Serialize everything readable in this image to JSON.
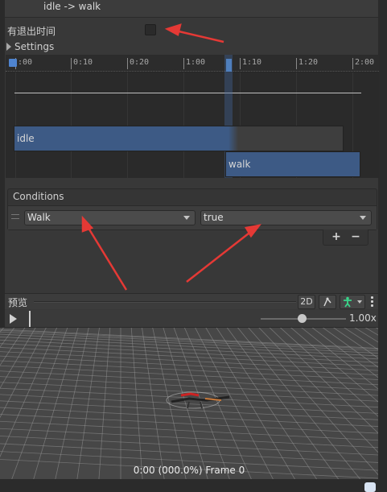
{
  "header": {
    "title": "idle -> walk"
  },
  "exit_time": {
    "label": "有退出时间",
    "checked": false
  },
  "settings": {
    "label": "Settings"
  },
  "timeline": {
    "ticks": [
      ":00",
      "0:10",
      "0:20",
      "1:00",
      "1:10",
      "1:20",
      "2:00"
    ],
    "source_clip": "idle",
    "dest_clip": "walk"
  },
  "conditions": {
    "title": "Conditions",
    "items": [
      {
        "parameter": "Walk",
        "value": "true"
      }
    ],
    "add_label": "+",
    "remove_label": "−"
  },
  "preview": {
    "title": "预览",
    "mode_2d": "2D",
    "speed": "1.00x",
    "frame_status": "0:00 (000.0%) Frame 0"
  },
  "colors": {
    "accent": "#3d5a85",
    "annotation_arrow": "#e53935"
  }
}
